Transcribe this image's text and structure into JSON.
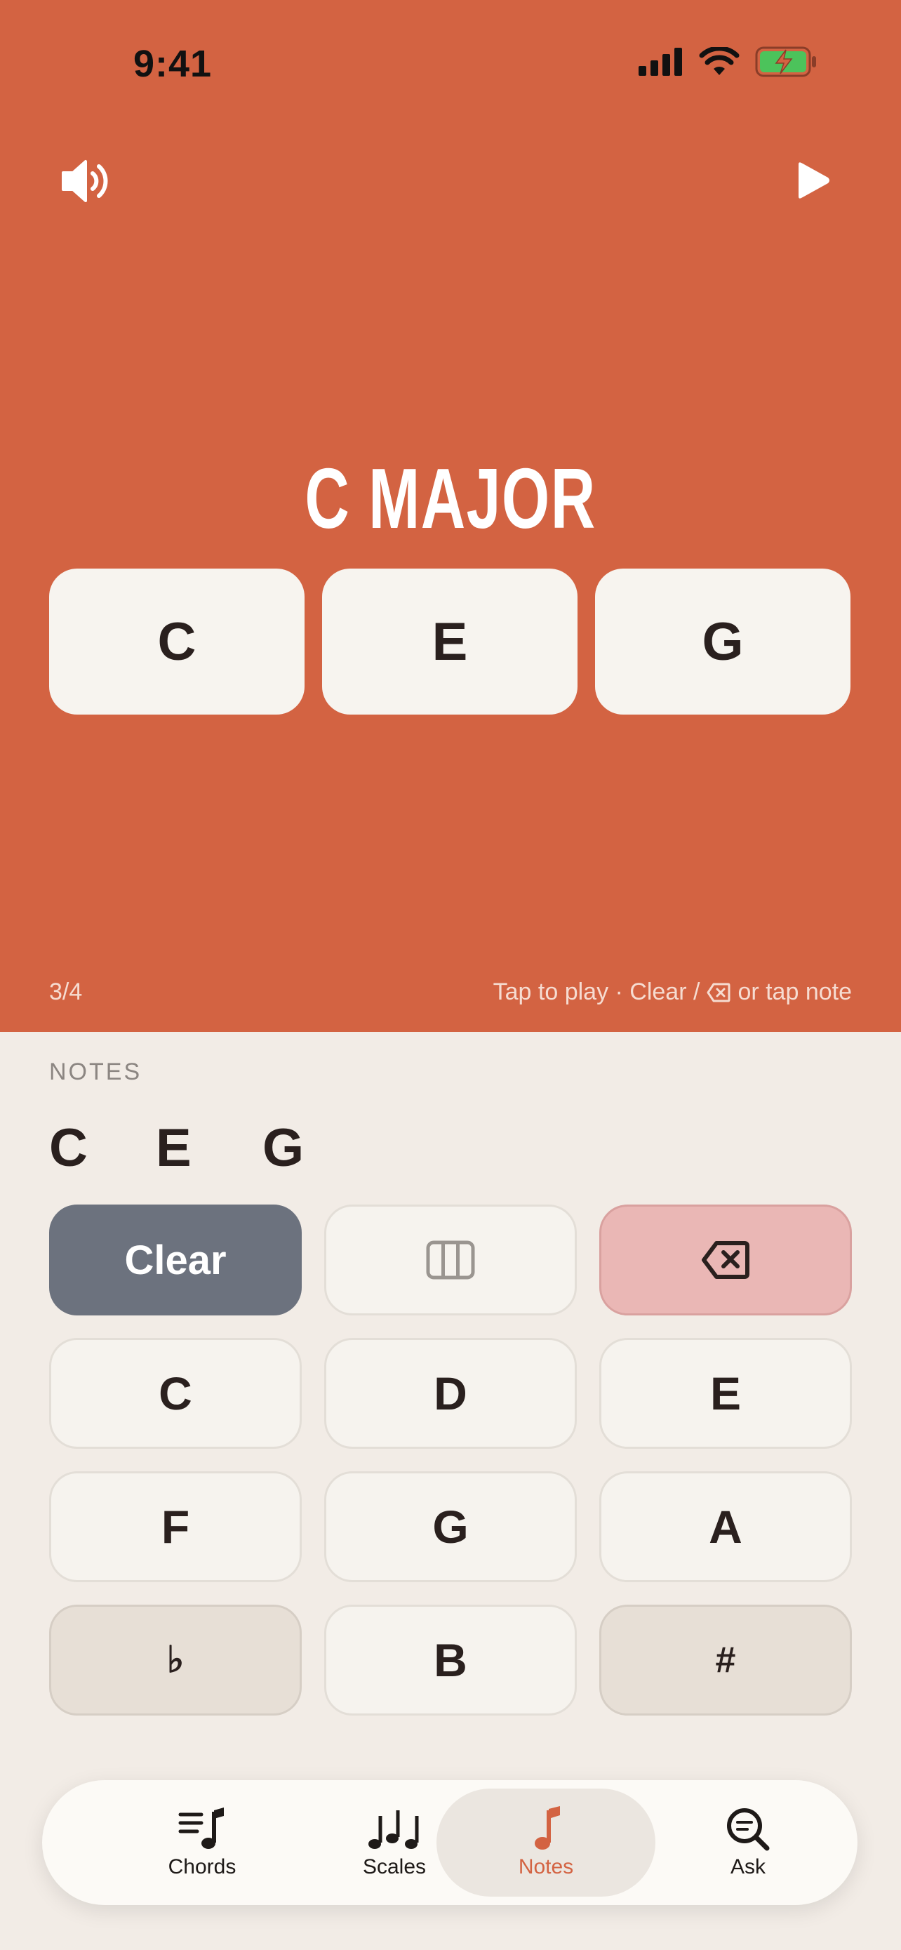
{
  "status_bar": {
    "time": "9:41"
  },
  "colors": {
    "accent": "#D36342",
    "clear": "#6C727E",
    "delete": "#EAB7B5",
    "page": "#F2ECE6",
    "battery": "#4CC35B"
  },
  "header": {
    "sound_icon": "speaker-icon",
    "play_icon": "play-icon"
  },
  "chord": {
    "name": "C MAJOR",
    "notes": [
      "C",
      "E",
      "G"
    ]
  },
  "progress": "3/4",
  "hint": {
    "before": "Tap to play · Clear /",
    "after": "or tap note"
  },
  "notes_section": {
    "label": "NOTES",
    "entered": [
      "C",
      "E",
      "G"
    ]
  },
  "keypad": {
    "clear_label": "Clear",
    "piano_icon": "piano-keys-icon",
    "delete_icon": "backspace-icon",
    "keys": [
      "C",
      "D",
      "E",
      "F",
      "G",
      "A",
      "♭",
      "B",
      "#"
    ]
  },
  "tabs": [
    {
      "label": "Chords",
      "icon": "chords-icon"
    },
    {
      "label": "Scales",
      "icon": "scales-icon"
    },
    {
      "label": "Notes",
      "icon": "note-icon",
      "active": true
    },
    {
      "label": "Ask",
      "icon": "search-chat-icon"
    }
  ]
}
